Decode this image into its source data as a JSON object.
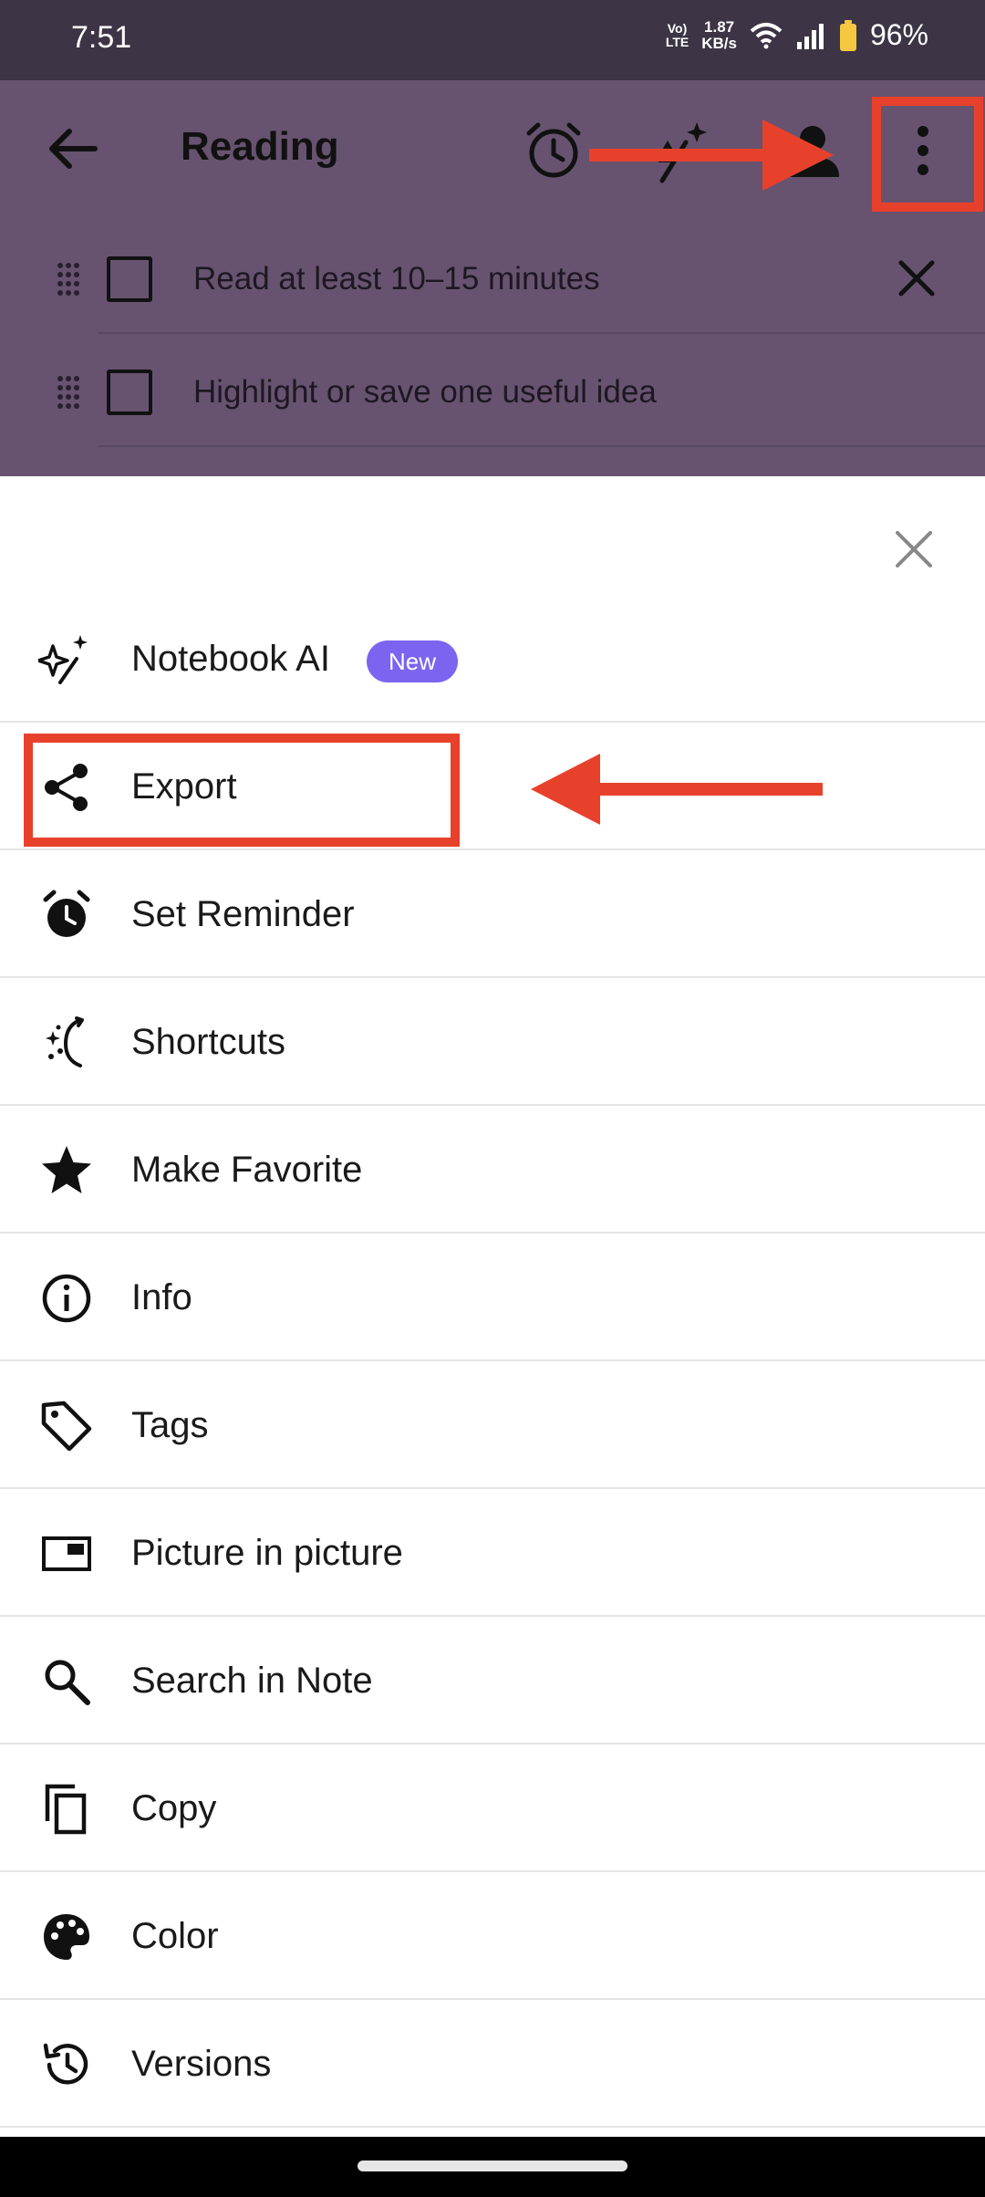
{
  "status_bar": {
    "time": "7:51",
    "network_top": "Vo)",
    "network_bottom": "LTE",
    "speed_value": "1.87",
    "speed_unit": "KB/s",
    "battery": "96%",
    "icons": [
      "wifi-icon",
      "signal-icon",
      "battery-icon"
    ]
  },
  "header": {
    "title": "Reading",
    "icons": [
      "back-arrow-icon",
      "alarm-icon",
      "ai-sparkle-icon",
      "person-icon",
      "more-vert-icon"
    ]
  },
  "checklist": {
    "items": [
      {
        "text": "Read at least 10–15 minutes",
        "checked": false
      },
      {
        "text": "Highlight or save one useful idea",
        "checked": false
      }
    ]
  },
  "menu": {
    "items": [
      {
        "label": "Notebook AI",
        "icon": "ai-sparkle-icon",
        "badge": "New"
      },
      {
        "label": "Export",
        "icon": "share-icon"
      },
      {
        "label": "Set Reminder",
        "icon": "alarm-icon"
      },
      {
        "label": "Shortcuts",
        "icon": "shortcuts-icon"
      },
      {
        "label": "Make Favorite",
        "icon": "star-icon"
      },
      {
        "label": "Info",
        "icon": "info-icon"
      },
      {
        "label": "Tags",
        "icon": "tag-icon"
      },
      {
        "label": "Picture in picture",
        "icon": "picture-in-picture-icon"
      },
      {
        "label": "Search in Note",
        "icon": "search-icon"
      },
      {
        "label": "Copy",
        "icon": "copy-icon"
      },
      {
        "label": "Color",
        "icon": "palette-icon"
      },
      {
        "label": "Versions",
        "icon": "history-icon"
      }
    ]
  },
  "colors": {
    "header_bg": "#675370",
    "status_bar_bg": "#3d3445",
    "badge_bg": "#7c63f0",
    "annotation": "#e8412b"
  }
}
